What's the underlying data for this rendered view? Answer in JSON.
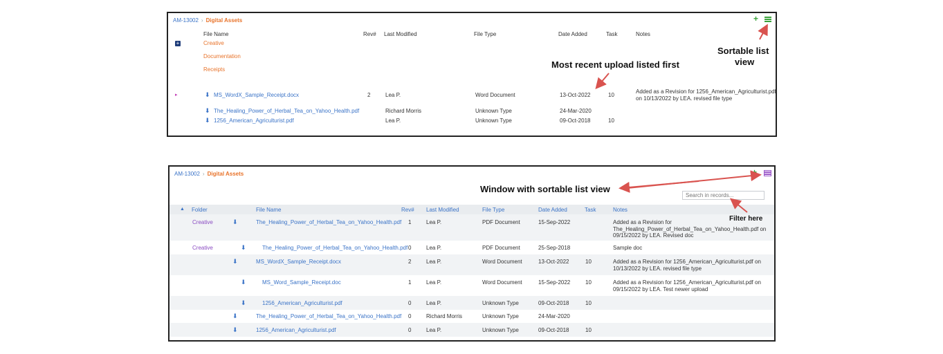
{
  "panel1": {
    "breadcrumb": {
      "project": "AM-13002",
      "separator": "›",
      "current": "Digital Assets"
    },
    "headers": [
      "File Name",
      "Rev#",
      "Last Modified",
      "File Type",
      "Date Added",
      "Task",
      "Notes"
    ],
    "folders": [
      "Creative",
      "Documentation",
      "Receipts"
    ],
    "rows": [
      {
        "file": "MS_WordX_Sample_Receipt.docx",
        "rev": "2",
        "modified": "Lea P.",
        "type": "Word Document",
        "date": "13-Oct-2022",
        "task": "10",
        "notes1": "Added as a Revision for 1256_American_Agriculturist.pdf",
        "notes2": "on 10/13/2022 by LEA. revised file type"
      },
      {
        "file": "The_Healing_Power_of_Herbal_Tea_on_Yahoo_Health.pdf",
        "rev": "",
        "modified": "Richard Morris",
        "type": "Unknown Type",
        "date": "24-Mar-2020",
        "task": "",
        "notes1": "",
        "notes2": ""
      },
      {
        "file": "1256_American_Agriculturist.pdf",
        "rev": "",
        "modified": "Lea P.",
        "type": "Unknown Type",
        "date": "09-Oct-2018",
        "task": "10",
        "notes1": "",
        "notes2": ""
      }
    ]
  },
  "panel2": {
    "breadcrumb": {
      "project": "AM-13002",
      "separator": "›",
      "current": "Digital Assets"
    },
    "search_placeholder": "Search in records...",
    "headers": [
      "Folder",
      "File Name",
      "Rev#",
      "Last Modified",
      "File Type",
      "Date Added",
      "Task",
      "Notes"
    ],
    "rows": [
      {
        "folder": "Creative",
        "file": "The_Healing_Power_of_Herbal_Tea_on_Yahoo_Health.pdf",
        "rev": "1",
        "modified": "Lea P.",
        "type": "PDF Document",
        "date": "15-Sep-2022",
        "task": "",
        "notes1": "Added as a Revision for",
        "notes2": "The_Healing_Power_of_Herbal_Tea_on_Yahoo_Health.pdf on",
        "notes3": "09/15/2022 by LEA. Revised doc"
      },
      {
        "folder": "Creative",
        "file": "The_Healing_Power_of_Herbal_Tea_on_Yahoo_Health.pdf",
        "rev": "0",
        "modified": "Lea P.",
        "type": "PDF Document",
        "date": "25-Sep-2018",
        "task": "",
        "notes1": "Sample doc",
        "notes2": "",
        "notes3": ""
      },
      {
        "folder": "",
        "file": "MS_WordX_Sample_Receipt.docx",
        "rev": "2",
        "modified": "Lea P.",
        "type": "Word Document",
        "date": "13-Oct-2022",
        "task": "10",
        "notes1": "Added as a Revision for 1256_American_Agriculturist.pdf on",
        "notes2": "10/13/2022 by LEA. revised file type",
        "notes3": ""
      },
      {
        "folder": "",
        "file": "MS_Word_Sample_Receipt.doc",
        "rev": "1",
        "modified": "Lea P.",
        "type": "Word Document",
        "date": "15-Sep-2022",
        "task": "10",
        "notes1": "Added as a Revision for 1256_American_Agriculturist.pdf on",
        "notes2": "09/15/2022 by LEA. Test newer upload",
        "notes3": ""
      },
      {
        "folder": "",
        "file": "1256_American_Agriculturist.pdf",
        "rev": "0",
        "modified": "Lea P.",
        "type": "Unknown Type",
        "date": "09-Oct-2018",
        "task": "10",
        "notes1": "",
        "notes2": "",
        "notes3": ""
      },
      {
        "folder": "",
        "file": "The_Healing_Power_of_Herbal_Tea_on_Yahoo_Health.pdf",
        "rev": "0",
        "modified": "Richard Morris",
        "type": "Unknown Type",
        "date": "24-Mar-2020",
        "task": "",
        "notes1": "",
        "notes2": "",
        "notes3": ""
      },
      {
        "folder": "",
        "file": "1256_American_Agriculturist.pdf",
        "rev": "0",
        "modified": "Lea P.",
        "type": "Unknown Type",
        "date": "09-Oct-2018",
        "task": "10",
        "notes1": "",
        "notes2": "",
        "notes3": ""
      }
    ]
  },
  "annotations": {
    "sortable": "Sortable list",
    "sortable2": "view",
    "recent": "Most recent upload listed first",
    "window": "Window with sortable list view",
    "filter": "Filter here"
  },
  "colors": {
    "accent_orange": "#e8732a",
    "link_blue": "#3a73c7",
    "annotation_red": "#d9534f",
    "add_green": "#3aa23a",
    "folder_purple": "#8a4bc2"
  },
  "icons": [
    "plus-icon",
    "list-view-icon",
    "download-icon",
    "expand-icon",
    "sort-caret-icon"
  ]
}
